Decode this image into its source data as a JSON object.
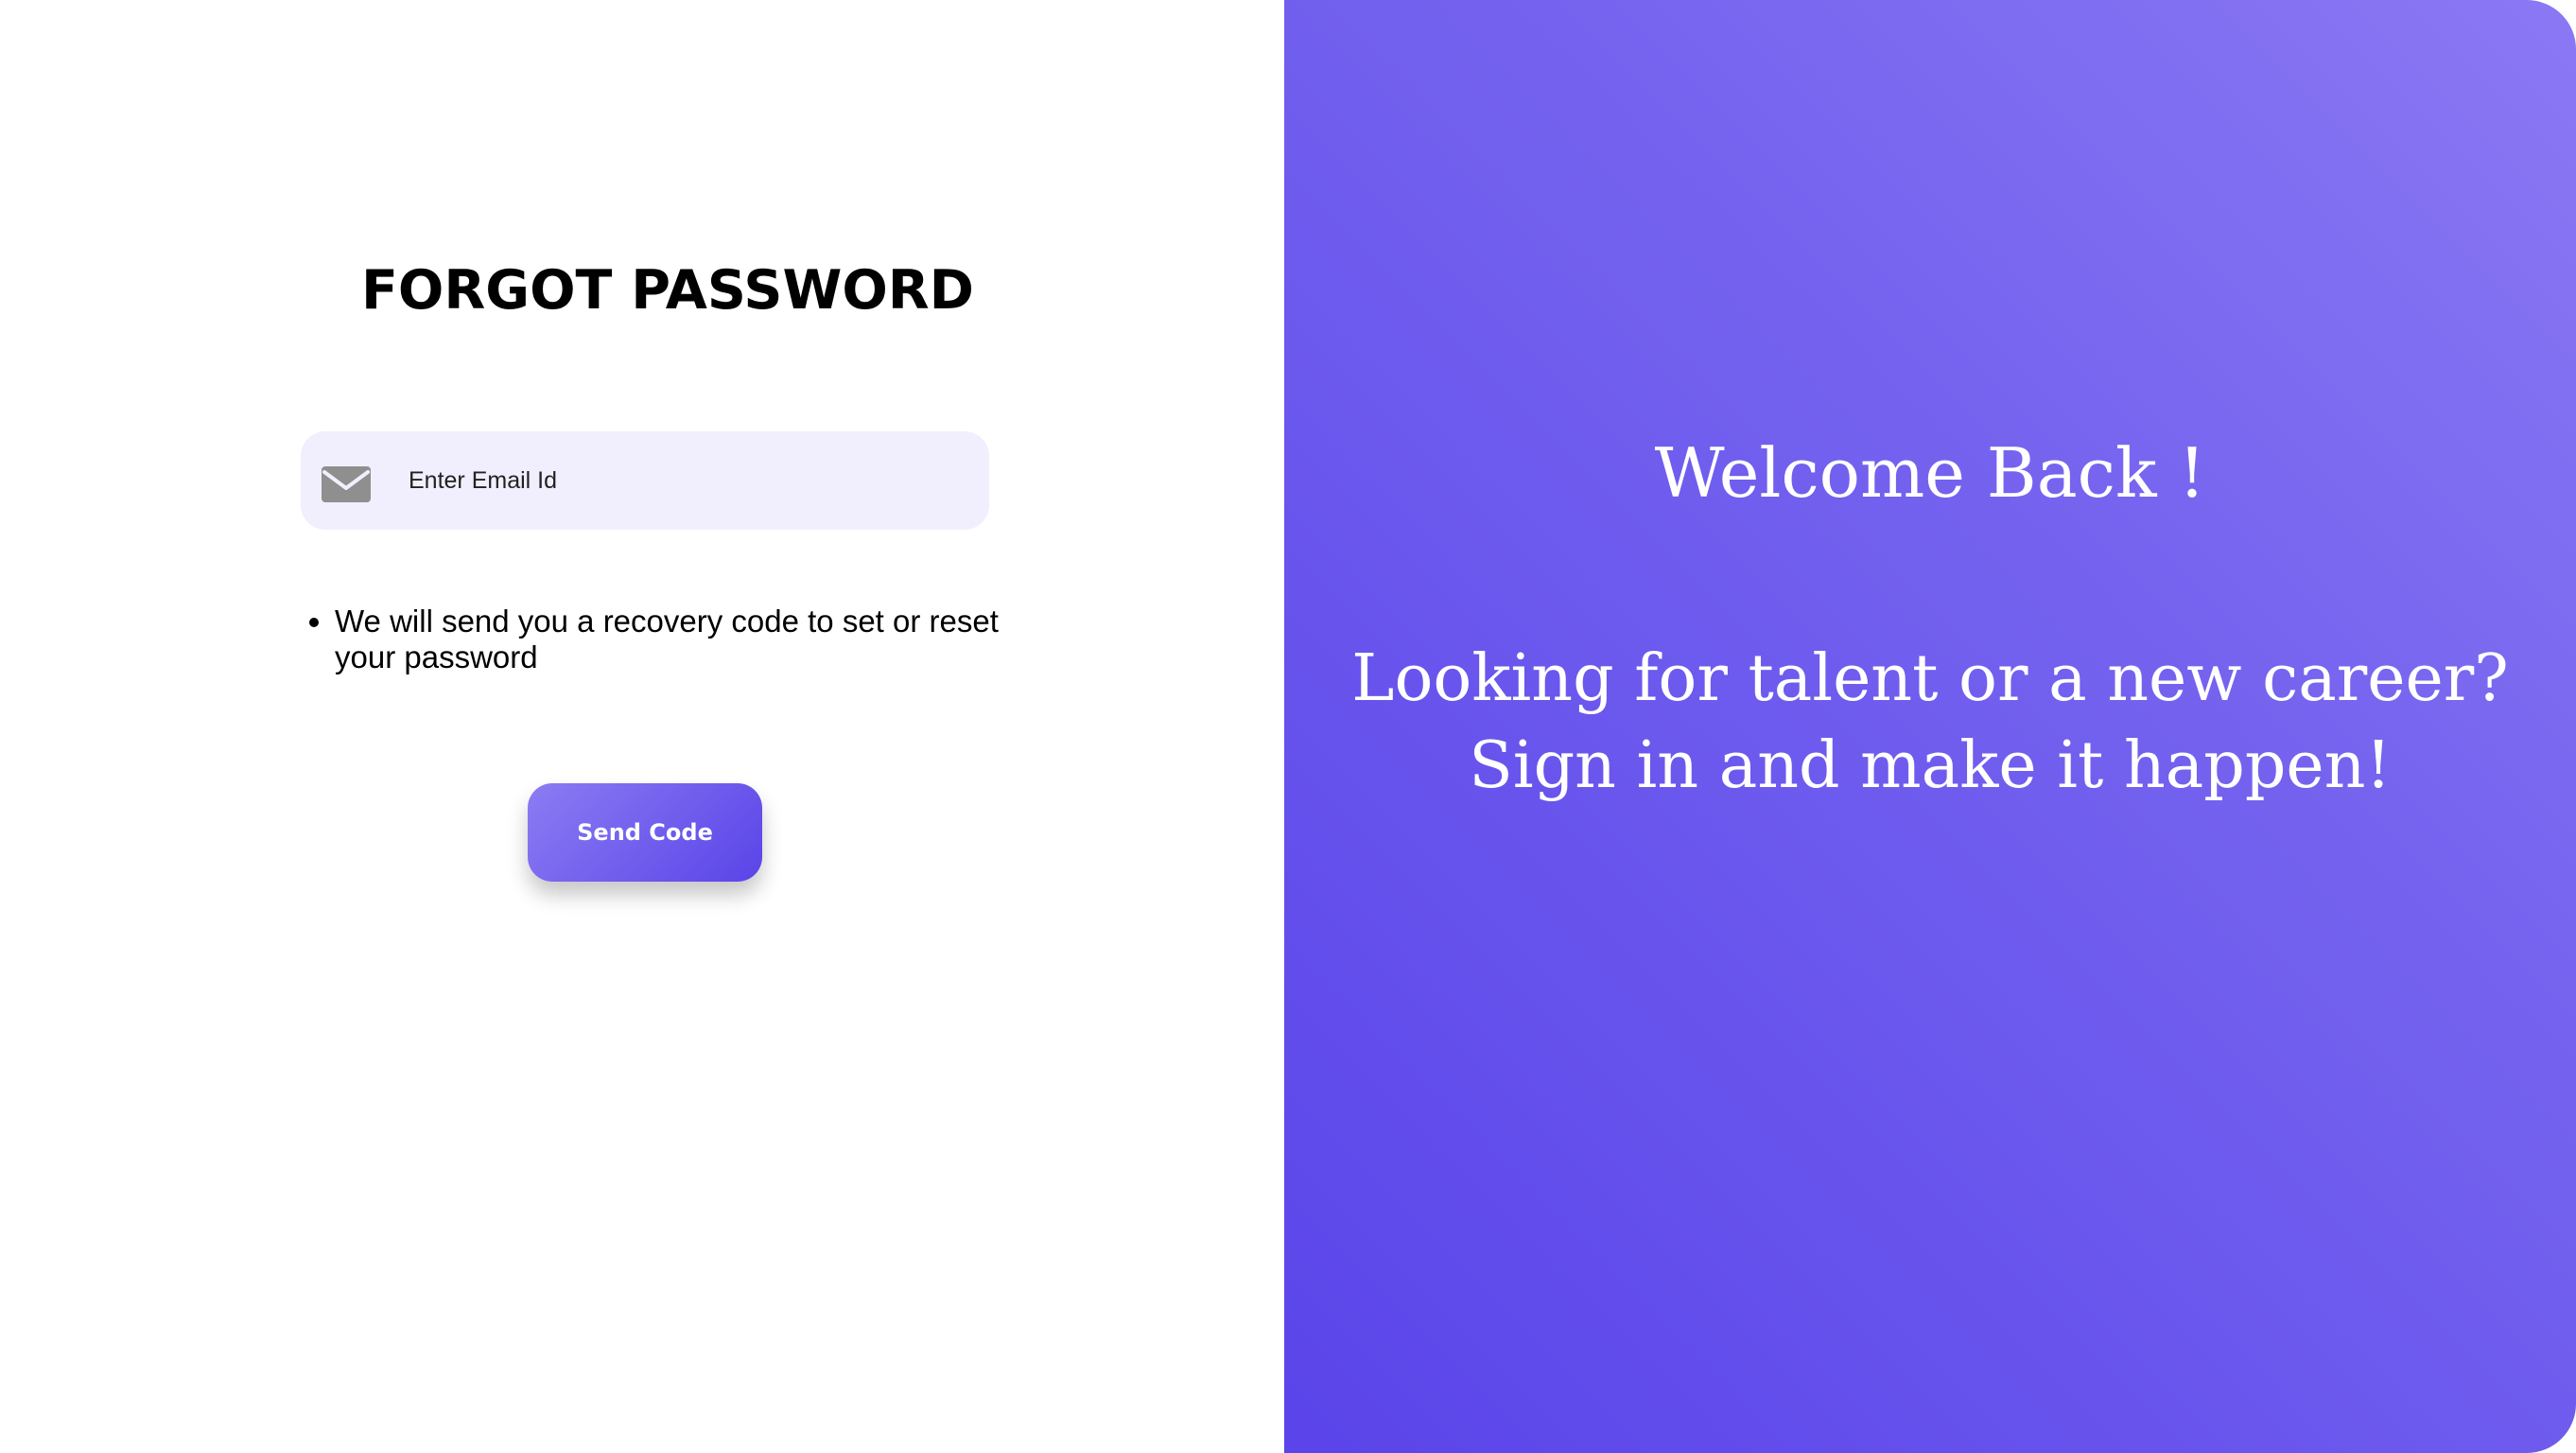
{
  "form": {
    "title": "FORGOT PASSWORD",
    "email_placeholder": "Enter Email Id",
    "email_value": "",
    "info_items": [
      "We will send you a recovery code to set or reset your password"
    ],
    "send_button_label": "Send Code"
  },
  "welcome": {
    "title": "Welcome Back !",
    "subtitle_lines": [
      "Looking for talent or a new career?",
      "Sign in and make it happen!"
    ]
  },
  "icons": {
    "email": "mail-icon"
  },
  "colors": {
    "accent": "#6a56ee",
    "accent_light": "#8c7cf3",
    "accent_dark": "#5a44e8",
    "input_background": "#f1effd",
    "title_text": "#000000",
    "panel_text": "#ffffff"
  }
}
